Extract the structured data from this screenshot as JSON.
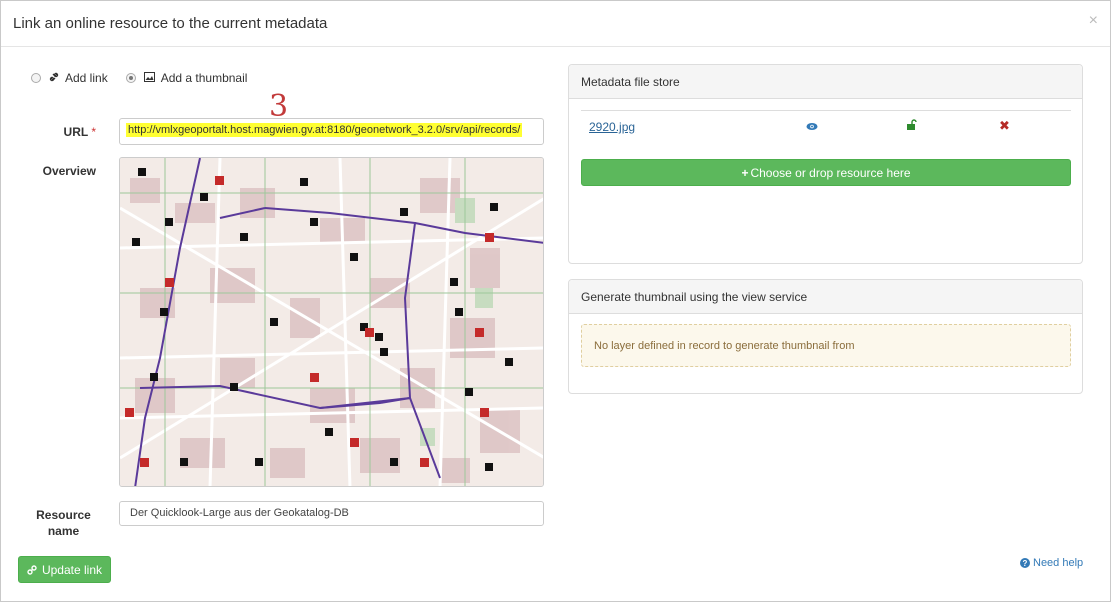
{
  "dialog": {
    "title": "Link an online resource to the current metadata",
    "close_symbol": "×"
  },
  "mode": {
    "options": [
      {
        "label": "Add link",
        "selected": false,
        "icon": "link-icon"
      },
      {
        "label": "Add a thumbnail",
        "selected": true,
        "icon": "image-icon"
      }
    ]
  },
  "form": {
    "url_label": "URL",
    "required_marker": "*",
    "url_value": "http://vmlxgeoportalt.host.magwien.gv.at:8180/geonetwork_3.2.0/srv/api/records/",
    "overview_label": "Overview",
    "resource_name_label_line1": "Resource",
    "resource_name_label_line2": "name",
    "resource_name_value": "Der Quicklook-Large aus der Geokatalog-DB",
    "annotation_mark": "3"
  },
  "buttons": {
    "update_link": "Update link",
    "choose_resource": "Choose or drop resource here",
    "need_help": "Need help"
  },
  "file_store": {
    "heading": "Metadata file store",
    "files": [
      {
        "name": "2920.jpg"
      }
    ]
  },
  "thumbnail_service": {
    "heading": "Generate thumbnail using the view service",
    "message": "No layer defined in record to generate thumbnail from"
  },
  "colors": {
    "success_green": "#5cb85c",
    "link_blue": "#337ab7",
    "highlight_yellow": "#ffff33",
    "danger_red": "#b52b27",
    "warning_text": "#8a6d3b"
  }
}
